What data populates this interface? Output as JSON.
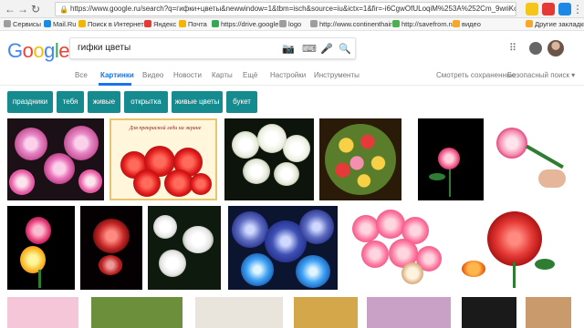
{
  "browser": {
    "url": "https://www.google.ru/search?q=гифки+цветы&newwindow=1&tbm=isch&source=iu&ictx=1&fir=-i6CgwOfULoqiM%253A%252Cm_9wnKcA0iWfRM%25...",
    "bookmarks": [
      "Сервисы",
      "Mail.Ru",
      "Поиск в Интернете",
      "Яндекс",
      "Почта",
      "https://drive.google",
      "logo",
      "http://www.continenthair",
      "http://savefrom.net/",
      "видео",
      "Другие закладки"
    ]
  },
  "search": {
    "query": "гифки цветы"
  },
  "tabs": {
    "items": [
      "Все",
      "Картинки",
      "Видео",
      "Новости",
      "Карты",
      "Ещё",
      "Настройки",
      "Инструменты"
    ],
    "active": "Картинки",
    "saved": "Смотреть сохраненные",
    "safesearch": "Безопасный поиск ▾"
  },
  "chips": [
    "праздники",
    "тебя",
    "живые",
    "открытка",
    "живые цветы",
    "букет"
  ],
  "images": [
    {
      "caption": ""
    },
    {
      "caption": "Для прекрасной леди на экране"
    },
    {
      "caption": ""
    },
    {
      "caption": ""
    },
    {
      "caption": ""
    },
    {
      "caption": ""
    },
    {
      "caption": ""
    },
    {
      "caption": ""
    },
    {
      "caption": ""
    },
    {
      "caption": ""
    },
    {
      "caption": ""
    }
  ],
  "colors": {
    "chip": "#168b8f",
    "accent": "#1a73e8"
  }
}
